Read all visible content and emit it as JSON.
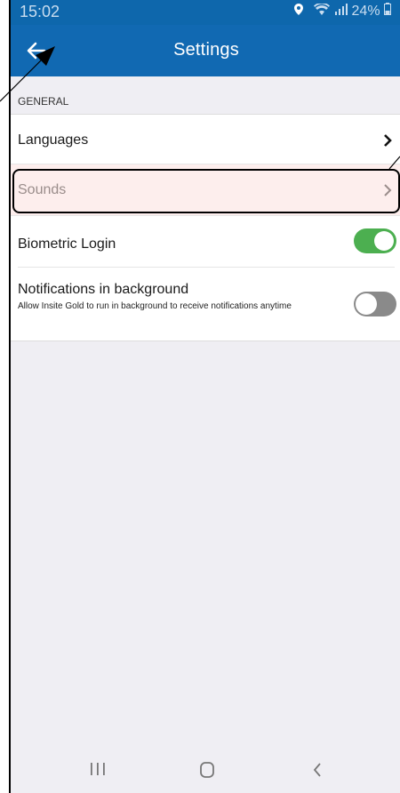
{
  "status_bar": {
    "time": "15:02",
    "battery": "24%",
    "icons": [
      "location-icon",
      "wifi-icon",
      "signal-icon",
      "battery-icon"
    ]
  },
  "app_bar": {
    "title": "Settings",
    "back_icon": "arrow-left-icon"
  },
  "section": {
    "header": "GENERAL"
  },
  "settings": {
    "languages": {
      "label": "Languages",
      "icon": "chevron-right-icon"
    },
    "sounds": {
      "label": "Sounds",
      "icon": "chevron-right-icon"
    },
    "biometric": {
      "label": "Biometric Login",
      "enabled": true
    },
    "notifications": {
      "label": "Notifications in background",
      "description": "Allow Insite Gold to run in background to receive notifications anytime",
      "enabled": false
    }
  },
  "nav_bar": {
    "icons": [
      "recent-apps-icon",
      "home-icon",
      "back-icon"
    ]
  },
  "colors": {
    "app_bar": "#1169b2",
    "toggle_on": "#4caf50",
    "toggle_off": "#8a8a8a",
    "highlight_row": "#fdeeed"
  }
}
